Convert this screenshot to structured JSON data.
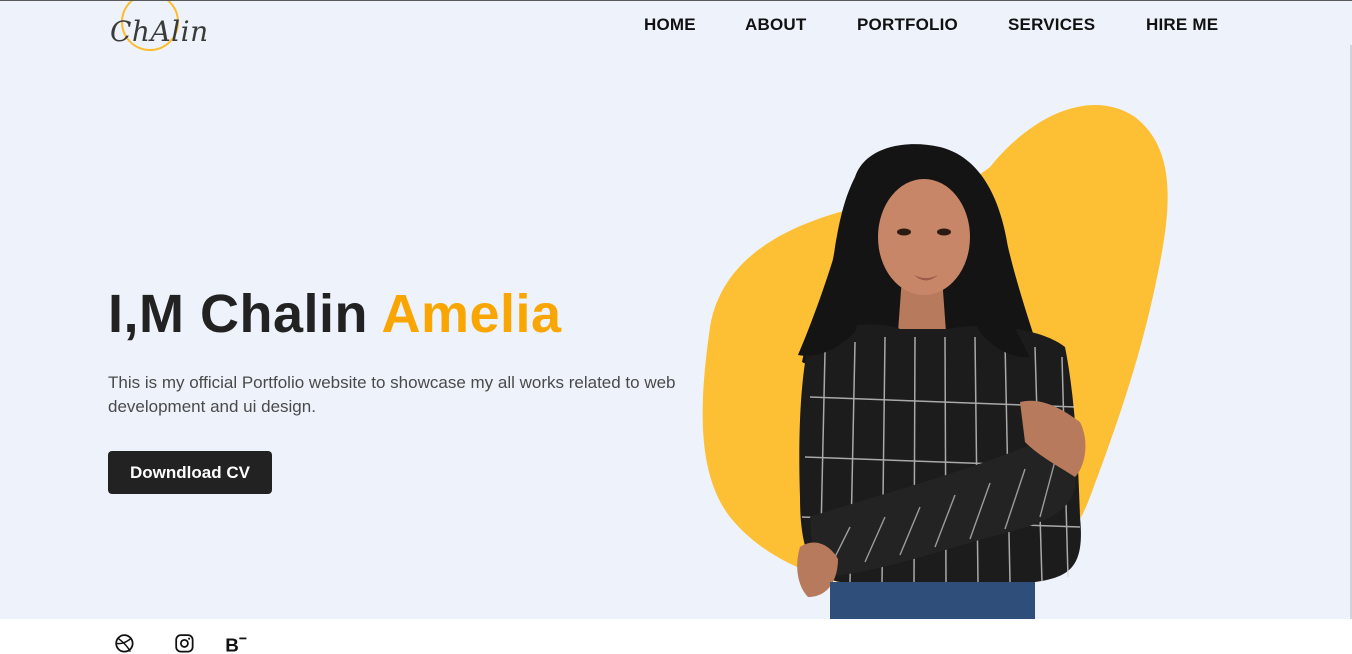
{
  "brand": {
    "logo_text": "ChAlin",
    "accent_color": "#fdbb2d",
    "highlight_color": "#f9a602"
  },
  "nav": {
    "items": [
      {
        "label": "HOME"
      },
      {
        "label": "ABOUT"
      },
      {
        "label": "PORTFOLIO"
      },
      {
        "label": "SERVICES"
      },
      {
        "label": "HIRE ME"
      }
    ]
  },
  "hero": {
    "title_prefix": "I,M Chalin",
    "title_highlight": "Amelia",
    "description": "This is my official Portfolio website to showcase my all works related to web development and ui design.",
    "cta_label": "Downdload CV",
    "portrait_alt": "portrait photo"
  },
  "social": {
    "icons": [
      "dribbble-icon",
      "instagram-icon",
      "behance-icon"
    ]
  },
  "colors": {
    "hero_background": "#eef3fb",
    "blob": "#fdbf33",
    "button_background": "#222222"
  }
}
